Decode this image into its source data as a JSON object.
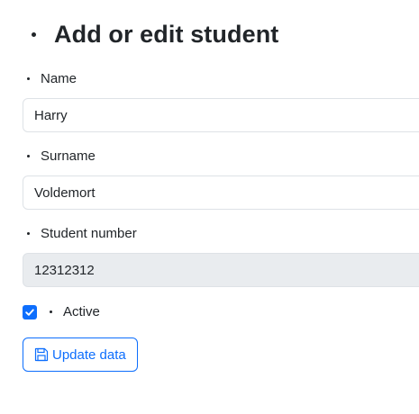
{
  "page": {
    "title": "Add or edit student"
  },
  "form": {
    "name": {
      "label": "Name",
      "value": "Harry"
    },
    "surname": {
      "label": "Surname",
      "value": "Voldemort"
    },
    "student_number": {
      "label": "Student number",
      "value": "12312312"
    },
    "active": {
      "label": "Active",
      "checked": true
    },
    "submit": {
      "label": "Update data",
      "icon": "floppy-disk-icon"
    }
  },
  "colors": {
    "accent": "#0d6efd",
    "text": "#212529",
    "border": "#dee2e6",
    "disabled_bg": "#e9ecef"
  }
}
